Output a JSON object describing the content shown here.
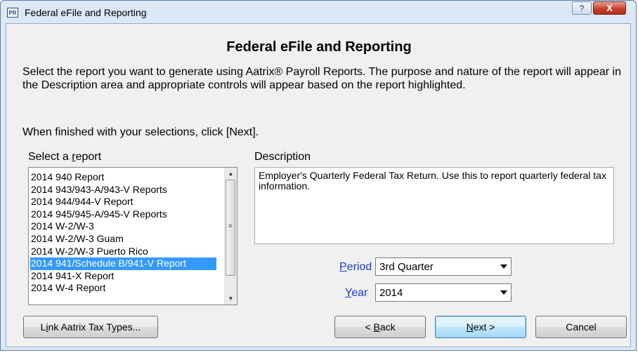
{
  "window": {
    "app_icon": "PR",
    "title": "Federal eFile and Reporting",
    "help_symbol": "?",
    "close_symbol": "X"
  },
  "heading": "Federal eFile and Reporting",
  "intro": "Select the report you want to generate using Aatrix® Payroll Reports.  The purpose and nature of the report will appear in the Description area and appropriate controls will appear based on the report highlighted.",
  "finish_text": "When finished with your selections, click [Next].",
  "report_list": {
    "label_pre": "Select a ",
    "label_key": "r",
    "label_post": "eport",
    "items": [
      "2014 940 Report",
      "2014 943/943-A/943-V Reports",
      "2014 944/944-V Report",
      "2014 945/945-A/945-V Reports",
      "2014 W-2/W-3",
      "2014 W-2/W-3 Guam",
      "2014 W-2/W-3 Puerto Rico",
      "2014 941/Schedule B/941-V Report",
      "2014 941-X Report",
      "2014 W-4 Report"
    ],
    "selected_index": 7
  },
  "description": {
    "label": "Description",
    "text": "Employer's Quarterly Federal Tax Return.  Use this to report quarterly federal tax information."
  },
  "period": {
    "label_key": "P",
    "label_rest": "eriod",
    "value": "3rd Quarter"
  },
  "year": {
    "label_key": "Y",
    "label_rest": "ear",
    "value": "2014"
  },
  "buttons": {
    "link": {
      "pre": "L",
      "key": "i",
      "post": "nk Aatrix Tax Types..."
    },
    "back": {
      "pre": "< ",
      "key": "B",
      "post": "ack"
    },
    "next": {
      "pre": "",
      "key": "N",
      "post": "ext >"
    },
    "cancel": "Cancel"
  }
}
